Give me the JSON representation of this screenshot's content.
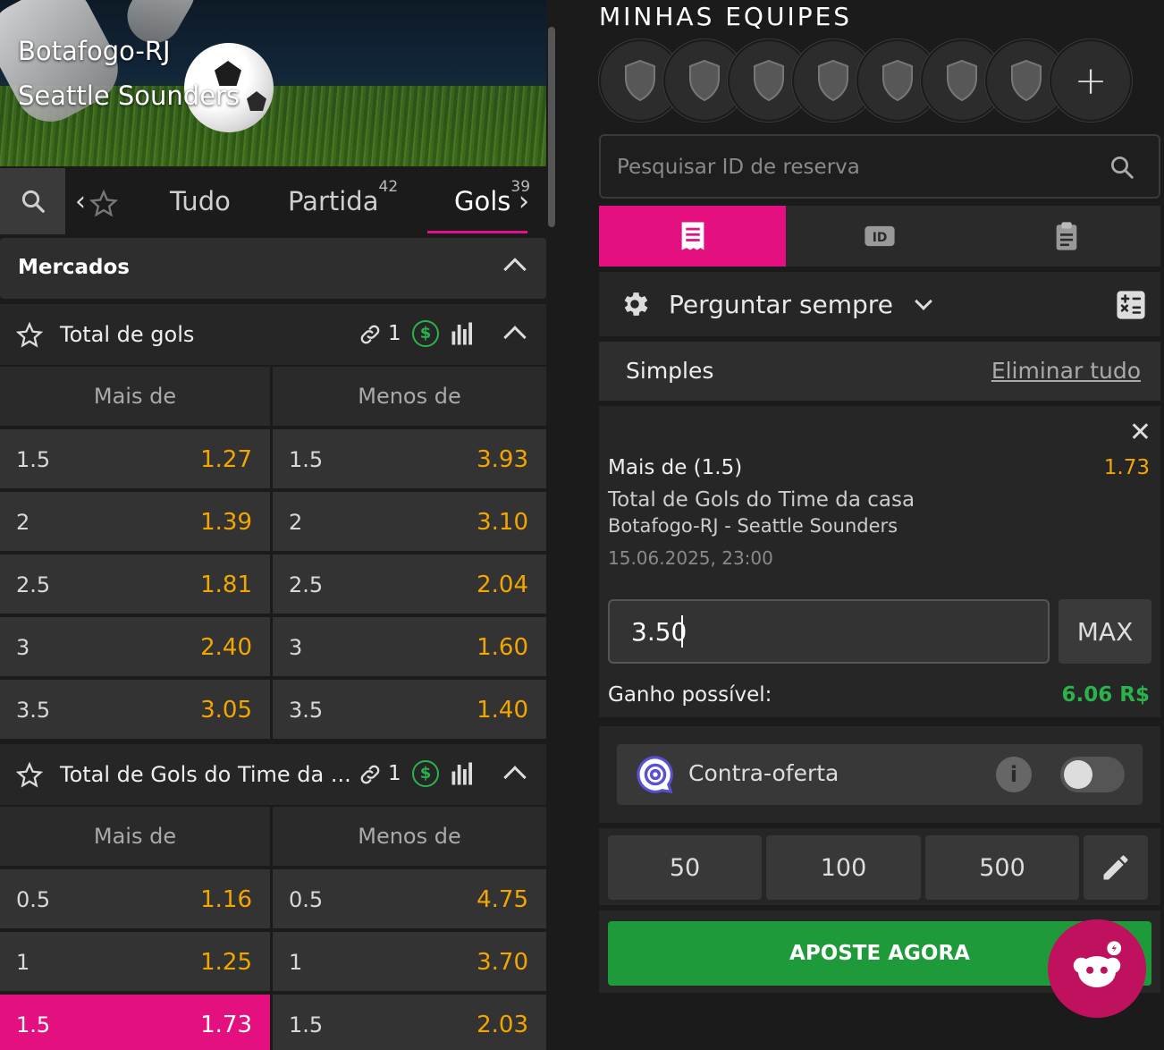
{
  "match": {
    "home": "Botafogo-RJ",
    "away": "Seattle Sounders"
  },
  "tabs": [
    {
      "label": "Tudo",
      "count": ""
    },
    {
      "label": "Partida",
      "count": "42"
    },
    {
      "label": "Gols",
      "count": "39"
    }
  ],
  "markets_header": "Mercados",
  "market1": {
    "name": "Total de gols",
    "link_count": "1",
    "col_over": "Mais de",
    "col_under": "Menos de",
    "rows": [
      {
        "over_line": "1.5",
        "over_odd": "1.27",
        "under_line": "1.5",
        "under_odd": "3.93"
      },
      {
        "over_line": "2",
        "over_odd": "1.39",
        "under_line": "2",
        "under_odd": "3.10"
      },
      {
        "over_line": "2.5",
        "over_odd": "1.81",
        "under_line": "2.5",
        "under_odd": "2.04"
      },
      {
        "over_line": "3",
        "over_odd": "2.40",
        "under_line": "3",
        "under_odd": "1.60"
      },
      {
        "over_line": "3.5",
        "over_odd": "3.05",
        "under_line": "3.5",
        "under_odd": "1.40"
      }
    ]
  },
  "market2": {
    "name": "Total de Gols do Time da ...",
    "link_count": "1",
    "col_over": "Mais de",
    "col_under": "Menos de",
    "rows": [
      {
        "over_line": "0.5",
        "over_odd": "1.16",
        "under_line": "0.5",
        "under_odd": "4.75"
      },
      {
        "over_line": "1",
        "over_odd": "1.25",
        "under_line": "1",
        "under_odd": "3.70"
      },
      {
        "over_line": "1.5",
        "over_odd": "1.73",
        "under_line": "1.5",
        "under_odd": "2.03"
      }
    ]
  },
  "right": {
    "title": "MINHAS EQUIPES",
    "search_placeholder": "Pesquisar ID de reserva",
    "setting_label": "Perguntar sempre",
    "bet_type": "Simples",
    "clear_all": "Eliminar tudo",
    "slip": {
      "selection": "Mais de (1.5)",
      "odd": "1.73",
      "market": "Total de Gols do Time da casa",
      "event": "Botafogo-RJ - Seattle Sounders",
      "date": "15.06.2025, 23:00",
      "stake": "3.50",
      "max_label": "MAX",
      "gain_label": "Ganho possível:",
      "gain_value": "6.06 R$"
    },
    "counter_offer": "Contra-oferta",
    "quick_stakes": [
      "50",
      "100",
      "500"
    ],
    "bet_button": "APOSTE AGORA"
  },
  "colors": {
    "accent": "#e4107f",
    "odd": "#f2a600",
    "green": "#1f9a3a"
  }
}
